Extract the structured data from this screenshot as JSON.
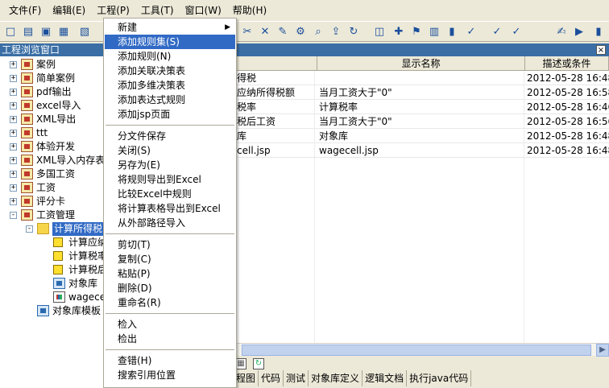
{
  "menubar": [
    "文件(F)",
    "编辑(E)",
    "工程(P)",
    "工具(T)",
    "窗口(W)",
    "帮助(H)"
  ],
  "toolbar": {
    "icons": [
      "new-file-icon",
      "open-folder-icon",
      "save-icon",
      "save-all-icon",
      "print-icon",
      "cut-icon",
      "delete-icon",
      "edit-doc-icon",
      "settings-icon",
      "find-icon",
      "export-icon",
      "refresh-icon",
      "module-icon",
      "add-icon",
      "flag-icon",
      "table-icon",
      "chart-icon",
      "check-icon",
      "check-alt-icon",
      "check-multi-icon",
      "edit-icon",
      "run-icon",
      "bar-icon"
    ]
  },
  "panel": {
    "title": "工程浏览窗口",
    "close": "×"
  },
  "tree": [
    {
      "label": "案例",
      "level": 0,
      "expander": "+",
      "icon": "folder"
    },
    {
      "label": "简单案例",
      "level": 0,
      "expander": "+",
      "icon": "folder"
    },
    {
      "label": "pdf输出",
      "level": 0,
      "expander": "+",
      "icon": "folder"
    },
    {
      "label": "excel导入",
      "level": 0,
      "expander": "+",
      "icon": "folder"
    },
    {
      "label": "XML导出",
      "level": 0,
      "expander": "+",
      "icon": "folder"
    },
    {
      "label": "ttt",
      "level": 0,
      "expander": "+",
      "icon": "folder"
    },
    {
      "label": "体验开发",
      "level": 0,
      "expander": "+",
      "icon": "folder"
    },
    {
      "label": "XML导入内存表",
      "level": 0,
      "expander": "+",
      "icon": "folder"
    },
    {
      "label": "多国工资",
      "level": 0,
      "expander": "+",
      "icon": "folder"
    },
    {
      "label": "工资",
      "level": 0,
      "expander": "+",
      "icon": "folder"
    },
    {
      "label": "评分卡",
      "level": 0,
      "expander": "+",
      "icon": "folder"
    },
    {
      "label": "工资管理",
      "level": 0,
      "expander": "-",
      "icon": "folder"
    },
    {
      "label": "计算所得税",
      "level": 1,
      "expander": "-",
      "icon": "open",
      "selected": true
    },
    {
      "label": "计算应纳",
      "level": 2,
      "expander": "",
      "icon": "item"
    },
    {
      "label": "计算税率",
      "level": 2,
      "expander": "",
      "icon": "item"
    },
    {
      "label": "计算税后",
      "level": 2,
      "expander": "",
      "icon": "item"
    },
    {
      "label": "对象库",
      "level": 2,
      "expander": "",
      "icon": "lib"
    },
    {
      "label": "wagecell",
      "level": 2,
      "expander": "",
      "icon": "chart"
    },
    {
      "label": "对象库模板",
      "level": 1,
      "expander": "",
      "icon": "lib"
    }
  ],
  "table": {
    "headers": [
      "",
      "显示名称",
      "描述或条件"
    ],
    "rows": [
      {
        "name": "得税",
        "display": "",
        "desc": "2012-05-28 16:48"
      },
      {
        "name": "应纳所得税额",
        "display": "当月工资大于\"0\"",
        "desc": "2012-05-28 16:58"
      },
      {
        "name": "税率",
        "display": "计算税率",
        "desc": "2012-05-28 16:46"
      },
      {
        "name": "税后工资",
        "display": "当月工资大于\"0\"",
        "desc": "2012-05-28 16:56"
      },
      {
        "name": "库",
        "display": "对象库",
        "desc": "2012-05-28 16:48"
      },
      {
        "name": "cell.jsp",
        "display": "wagecell.jsp",
        "desc": "2012-05-28 16:48"
      }
    ]
  },
  "bottom_tabs": [
    "程图",
    "代码",
    "测试",
    "对象库定义",
    "逻辑文档",
    "执行java代码"
  ],
  "context_menu": [
    {
      "label": "新建",
      "submenu": true
    },
    {
      "label": "添加规则集(S)",
      "highlighted": true
    },
    {
      "label": "添加规则(N)"
    },
    {
      "label": "添加关联决策表"
    },
    {
      "label": "添加多维决策表"
    },
    {
      "label": "添加表达式规则"
    },
    {
      "label": "添加jsp页面"
    },
    {
      "separator": true
    },
    {
      "label": "分文件保存"
    },
    {
      "label": "关闭(S)"
    },
    {
      "label": "另存为(E)"
    },
    {
      "label": "将规则导出到Excel"
    },
    {
      "label": "比较Excel中规则"
    },
    {
      "label": "将计算表格导出到Excel"
    },
    {
      "label": "从外部路径导入"
    },
    {
      "separator": true
    },
    {
      "label": "剪切(T)"
    },
    {
      "label": "复制(C)"
    },
    {
      "label": "粘贴(P)"
    },
    {
      "label": "删除(D)"
    },
    {
      "label": "重命名(R)"
    },
    {
      "separator": true
    },
    {
      "label": "检入"
    },
    {
      "label": "检出"
    },
    {
      "separator": true
    },
    {
      "label": "查错(H)"
    },
    {
      "label": "搜索引用位置"
    }
  ]
}
